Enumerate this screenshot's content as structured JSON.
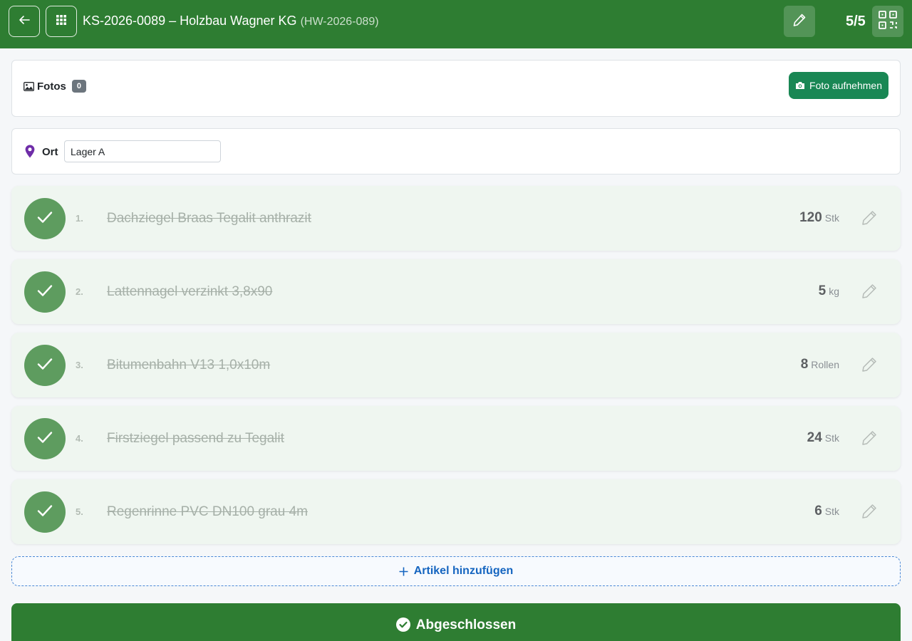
{
  "header": {
    "order_id": "KS-2026-0089",
    "separator": "–",
    "customer": "Holzbau Wagner KG",
    "customer_code": "(HW-2026-089)",
    "progress": "5/5",
    "back_icon": "arrow-left-icon",
    "apps_icon": "grid-icon",
    "edit_icon": "pencil-icon",
    "qr_icon": "qr-code-icon"
  },
  "photos": {
    "label": "Fotos",
    "count": "0",
    "add_label": "Foto aufnehmen",
    "icon": "image-icon",
    "add_icon": "camera-icon"
  },
  "location": {
    "label": "Ort",
    "value": "Lager A",
    "icon": "map-pin-icon"
  },
  "items": [
    {
      "num": "1.",
      "name": "Dachziegel Braas Tegalit anthrazit",
      "qty": "120",
      "unit": "Stk",
      "done": true
    },
    {
      "num": "2.",
      "name": "Lattennagel verzinkt 3,8x90",
      "qty": "5",
      "unit": "kg",
      "done": true
    },
    {
      "num": "3.",
      "name": "Bitumenbahn V13 1,0x10m",
      "qty": "8",
      "unit": "Rollen",
      "done": true
    },
    {
      "num": "4.",
      "name": "Firstziegel passend zu Tegalit",
      "qty": "24",
      "unit": "Stk",
      "done": true
    },
    {
      "num": "5.",
      "name": "Regenrinne PVC DN100 grau 4m",
      "qty": "6",
      "unit": "Stk",
      "done": true
    }
  ],
  "add_item": {
    "label": "Artikel hinzufügen",
    "icon": "plus-icon"
  },
  "complete": {
    "label": "Abgeschlossen",
    "icon": "check-circle-icon"
  },
  "colors": {
    "primary": "#2e7d32",
    "success_button": "#198754",
    "done_check": "#5e9c5f",
    "item_bg": "#eff6f0",
    "link_blue": "#1565c0",
    "pin_purple": "#6f2da8"
  }
}
